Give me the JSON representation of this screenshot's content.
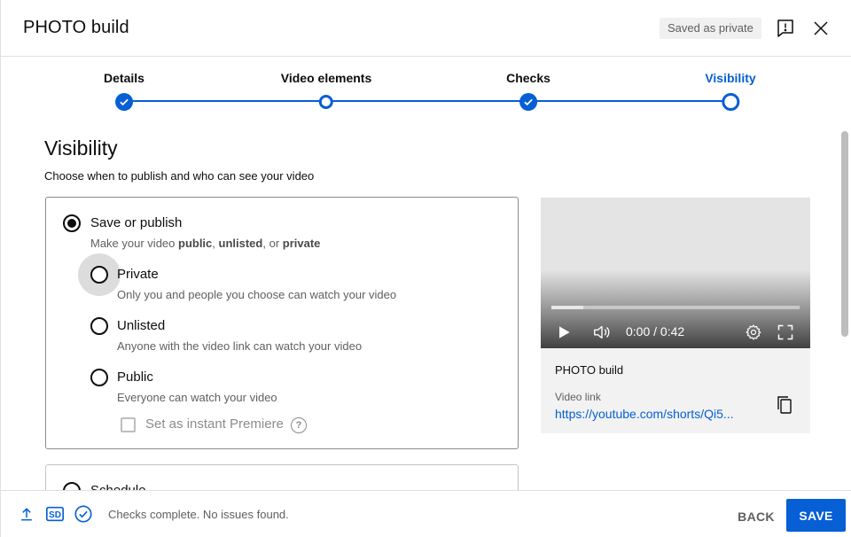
{
  "header": {
    "title": "PHOTO build",
    "saved_badge": "Saved as private"
  },
  "steps": [
    {
      "label": "Details",
      "state": "done"
    },
    {
      "label": "Video elements",
      "state": "open"
    },
    {
      "label": "Checks",
      "state": "done"
    },
    {
      "label": "Visibility",
      "state": "active"
    }
  ],
  "visibility": {
    "heading": "Visibility",
    "subheading": "Choose when to publish and who can see your video",
    "save_publish": {
      "title": "Save or publish",
      "desc_prefix": "Make your video ",
      "desc_public": "public",
      "desc_sep1": ", ",
      "desc_unlisted": "unlisted",
      "desc_sep2": ", or ",
      "desc_private": "private"
    },
    "options": [
      {
        "title": "Private",
        "desc": "Only you and people you choose can watch your video"
      },
      {
        "title": "Unlisted",
        "desc": "Anyone with the video link can watch your video"
      },
      {
        "title": "Public",
        "desc": "Everyone can watch your video"
      }
    ],
    "premiere_label": "Set as instant Premiere",
    "premiere_help": "?",
    "schedule_title": "Schedule"
  },
  "preview": {
    "time": "0:00 / 0:42",
    "progress_fraction": 0.13,
    "title": "PHOTO build",
    "link_label": "Video link",
    "link": "https://youtube.com/shorts/Qi5..."
  },
  "footer": {
    "status": "Checks complete. No issues found.",
    "back_label": "BACK",
    "save_label": "SAVE",
    "sd_badge": "SD"
  },
  "colors": {
    "accent": "#065fd4",
    "text": "#0d0d0d",
    "secondary": "#606060"
  }
}
